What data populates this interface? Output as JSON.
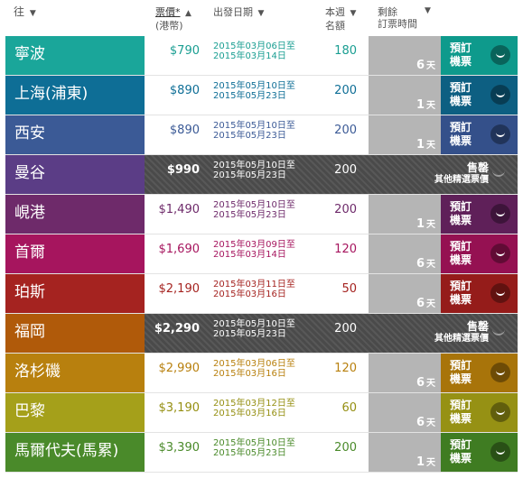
{
  "header": {
    "destination": "往",
    "price_main": "票價*",
    "price_sub": "(港幣)",
    "period": "出發日期",
    "quota_line1": "本週",
    "quota_line2": "名額",
    "remain_line1": "剩餘",
    "remain_line2": "訂票時間",
    "sort_arrow_down": "▼",
    "sort_arrow_up": "▲"
  },
  "book_label_line1": "預訂",
  "book_label_line2": "機票",
  "days_unit": "天",
  "sold_out_line1": "售罄",
  "sold_out_line2": "其他精選票價",
  "rows": [
    {
      "dest": "寧波",
      "price": "$790",
      "date1": "2015年03月06日至",
      "date2": "2015年03月14日",
      "quota": "180",
      "days": "6",
      "sold": false,
      "color": "#1aa69a",
      "text": "#1a9e92",
      "book": "#0e9a8c"
    },
    {
      "dest": "上海(浦東)",
      "price": "$890",
      "date1": "2015年05月10日至",
      "date2": "2015年05月23日",
      "quota": "200",
      "days": "1",
      "sold": false,
      "color": "#0e6e96",
      "text": "#0e6e96",
      "book": "#0d5f82"
    },
    {
      "dest": "西安",
      "price": "$890",
      "date1": "2015年05月10日至",
      "date2": "2015年05月23日",
      "quota": "200",
      "days": "1",
      "sold": false,
      "color": "#3b5a96",
      "text": "#3b5a96",
      "book": "#34508a"
    },
    {
      "dest": "曼谷",
      "price": "$990",
      "date1": "2015年05月10日至",
      "date2": "2015年05月23日",
      "quota": "200",
      "days": "",
      "sold": true,
      "color": "#5b3d86",
      "text": "#5b3d86",
      "book": "#5b3d86"
    },
    {
      "dest": "峴港",
      "price": "$1,490",
      "date1": "2015年05月10日至",
      "date2": "2015年05月23日",
      "quota": "200",
      "days": "1",
      "sold": false,
      "color": "#6e2a6a",
      "text": "#6e2a6a",
      "book": "#5f2059"
    },
    {
      "dest": "首爾",
      "price": "$1,690",
      "date1": "2015年03月09日至",
      "date2": "2015年03月14日",
      "quota": "120",
      "days": "6",
      "sold": false,
      "color": "#a6155e",
      "text": "#a6155e",
      "book": "#951152"
    },
    {
      "dest": "珀斯",
      "price": "$2,190",
      "date1": "2015年03月11日至",
      "date2": "2015年03月16日",
      "quota": "50",
      "days": "6",
      "sold": false,
      "color": "#a52320",
      "text": "#a52320",
      "book": "#951c1a"
    },
    {
      "dest": "福岡",
      "price": "$2,290",
      "date1": "2015年05月10日至",
      "date2": "2015年05月23日",
      "quota": "200",
      "days": "",
      "sold": true,
      "color": "#b05a0a",
      "text": "#b05a0a",
      "book": "#b05a0a"
    },
    {
      "dest": "洛杉磯",
      "price": "$2,990",
      "date1": "2015年03月06日至",
      "date2": "2015年03月16日",
      "quota": "120",
      "days": "6",
      "sold": false,
      "color": "#b8800e",
      "text": "#b8800e",
      "book": "#a8740a"
    },
    {
      "dest": "巴黎",
      "price": "$3,190",
      "date1": "2015年03月12日至",
      "date2": "2015年03月16日",
      "quota": "60",
      "days": "6",
      "sold": false,
      "color": "#a5a01a",
      "text": "#958f12",
      "book": "#969114"
    },
    {
      "dest": "馬爾代夫(馬累)",
      "price": "$3,390",
      "date1": "2015年05月10日至",
      "date2": "2015年05月23日",
      "quota": "200",
      "days": "1",
      "sold": false,
      "color": "#4a8a2a",
      "text": "#4a8a2a",
      "book": "#3f7c22"
    }
  ]
}
